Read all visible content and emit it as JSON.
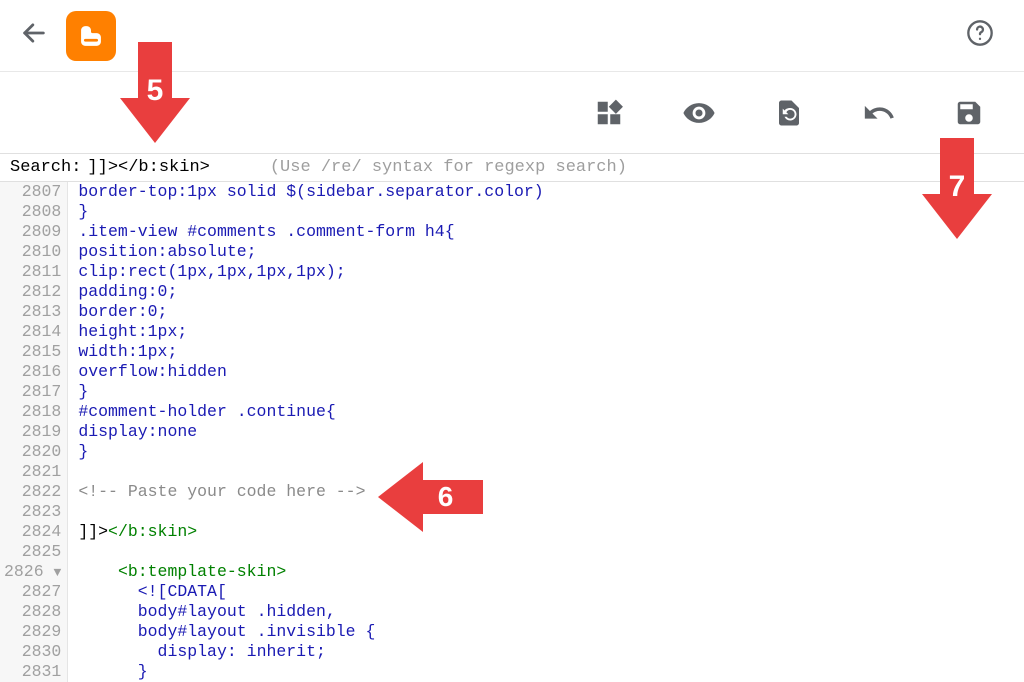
{
  "annotations": {
    "arrow5": "5",
    "arrow6": "6",
    "arrow7": "7"
  },
  "search": {
    "label": "Search:",
    "value": "]]></b:skin>",
    "hint": "(Use /re/ syntax for regexp search)"
  },
  "gutter": {
    "start": 2807,
    "fold_line": 2826
  },
  "lines": [
    {
      "n": "2807",
      "html": "<span class='tok-prop'>border-top:1px solid $(sidebar.separator.color)</span>"
    },
    {
      "n": "2808",
      "html": "<span class='tok-bracket'>}</span>"
    },
    {
      "n": "2809",
      "html": "<span class='tok-sel'>.item-view #comments .comment-form h4{</span>"
    },
    {
      "n": "2810",
      "html": "<span class='tok-prop'>position:absolute;</span>"
    },
    {
      "n": "2811",
      "html": "<span class='tok-prop'>clip:rect(1px,1px,1px,1px);</span>"
    },
    {
      "n": "2812",
      "html": "<span class='tok-prop'>padding:0;</span>"
    },
    {
      "n": "2813",
      "html": "<span class='tok-prop'>border:0;</span>"
    },
    {
      "n": "2814",
      "html": "<span class='tok-prop'>height:1px;</span>"
    },
    {
      "n": "2815",
      "html": "<span class='tok-prop'>width:1px;</span>"
    },
    {
      "n": "2816",
      "html": "<span class='tok-prop'>overflow:hidden</span>"
    },
    {
      "n": "2817",
      "html": "<span class='tok-bracket'>}</span>"
    },
    {
      "n": "2818",
      "html": "<span class='tok-sel'>#comment-holder .continue{</span>"
    },
    {
      "n": "2819",
      "html": "<span class='tok-prop'>display:none</span>"
    },
    {
      "n": "2820",
      "html": "<span class='tok-bracket'>}</span>"
    },
    {
      "n": "2821",
      "html": ""
    },
    {
      "n": "2822",
      "html": "<span class='tok-comment'>&lt;!-- Paste your code here --&gt;</span>"
    },
    {
      "n": "2823",
      "html": ""
    },
    {
      "n": "2824",
      "html": "<span class='tok-black'>]]&gt;</span><span class='tok-skin'>&lt;/b:skin&gt;</span>"
    },
    {
      "n": "2825",
      "html": ""
    },
    {
      "n": "2826",
      "html": "    <span class='tok-tag'>&lt;b:template-skin&gt;</span>"
    },
    {
      "n": "2827",
      "html": "      <span class='tok-cdata'>&lt;![CDATA[</span>"
    },
    {
      "n": "2828",
      "html": "      <span class='tok-sel'>body#layout .hidden,</span>"
    },
    {
      "n": "2829",
      "html": "      <span class='tok-sel'>body#layout .invisible {</span>"
    },
    {
      "n": "2830",
      "html": "        <span class='tok-prop'>display: inherit;</span>"
    },
    {
      "n": "2831",
      "html": "      <span class='tok-bracket'>}</span>"
    }
  ]
}
